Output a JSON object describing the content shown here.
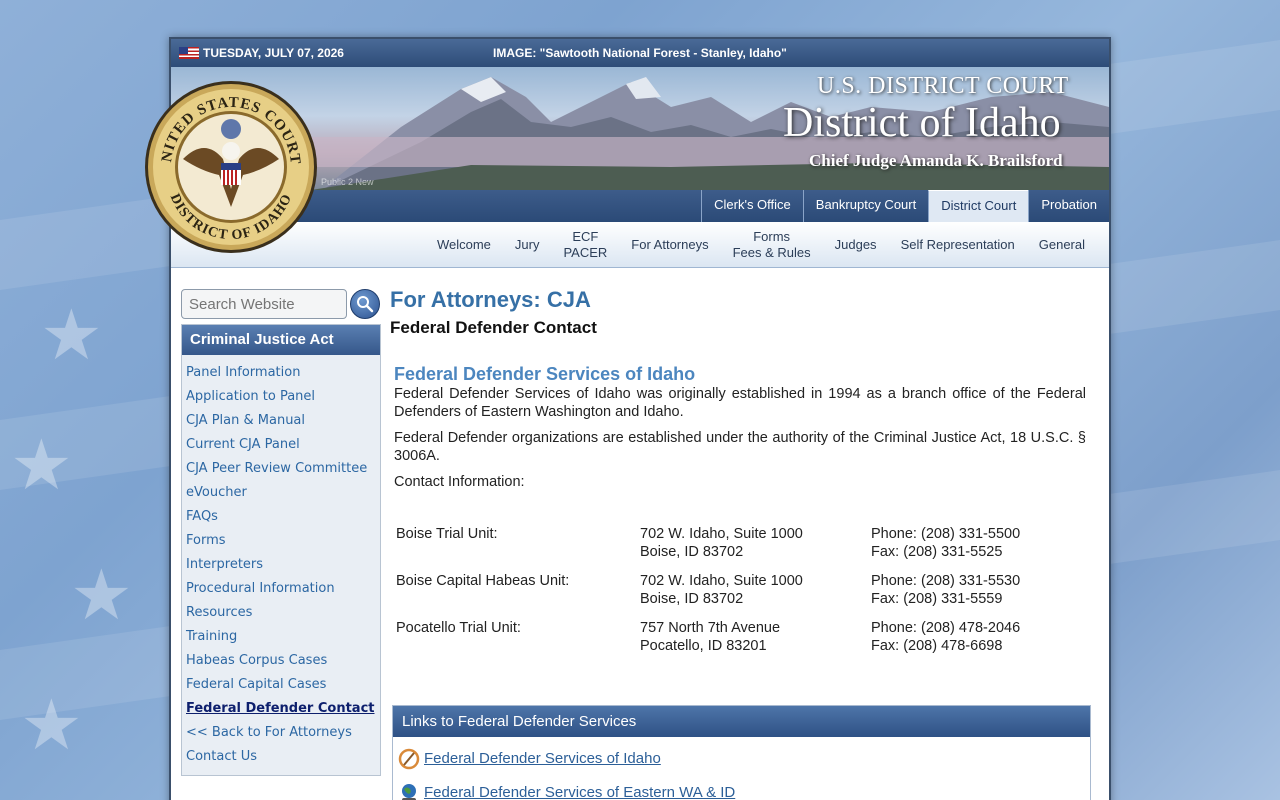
{
  "top_bar": {
    "date": "TUESDAY, JULY 07, 2026",
    "image_caption": "IMAGE: \"Sawtooth National Forest - Stanley, Idaho\""
  },
  "banner": {
    "court": "U.S. DISTRICT COURT",
    "district": "District of Idaho",
    "judge": "Chief Judge Amanda K. Brailsford",
    "small_text": "Public 2 New"
  },
  "seal": {
    "top_text": "UNITED STATES COURTS",
    "bottom_text": "DISTRICT OF IDAHO"
  },
  "tabs": [
    "Clerk's Office",
    "Bankruptcy Court",
    "District Court",
    "Probation"
  ],
  "active_tab": "District Court",
  "subnav": [
    {
      "line1": "Welcome",
      "line2": ""
    },
    {
      "line1": "Jury",
      "line2": ""
    },
    {
      "line1": "ECF",
      "line2": "PACER"
    },
    {
      "line1": "For Attorneys",
      "line2": ""
    },
    {
      "line1": "Forms",
      "line2": "Fees & Rules"
    },
    {
      "line1": "Judges",
      "line2": ""
    },
    {
      "line1": "Self Representation",
      "line2": ""
    },
    {
      "line1": "General",
      "line2": ""
    }
  ],
  "search": {
    "placeholder": "Search Website"
  },
  "sidebar": {
    "heading": "Criminal Justice Act",
    "items": [
      "Panel Information",
      "Application to Panel",
      "CJA Plan & Manual",
      "Current CJA Panel",
      "CJA Peer Review Committee",
      "eVoucher",
      "FAQs",
      "Forms",
      "Interpreters",
      "Procedural Information",
      "Resources",
      "Training",
      "Habeas Corpus Cases",
      "Federal Capital Cases",
      "Federal Defender Contact",
      "<< Back to For Attorneys",
      "Contact Us"
    ],
    "current_item": "Federal Defender Contact"
  },
  "main": {
    "title": "For Attorneys: CJA",
    "subtitle": "Federal Defender Contact",
    "section_title": "Federal Defender Services of Idaho",
    "para1": "Federal Defender Services of Idaho was originally established in 1994 as a branch office of the Federal Defenders of Eastern Washington and Idaho.",
    "para2": "Federal Defender organizations are established under the authority of the Criminal Justice Act, 18 U.S.C. § 3006A.",
    "para3": "Contact Information:",
    "contacts": [
      {
        "unit": "Boise Trial Unit:",
        "addr1": "702 W. Idaho, Suite 1000",
        "addr2": "Boise, ID  83702",
        "phone": "Phone: (208) 331-5500",
        "fax": "Fax: (208) 331-5525"
      },
      {
        "unit": "Boise Capital Habeas Unit:",
        "addr1": "702 W. Idaho, Suite 1000",
        "addr2": "Boise, ID  83702",
        "phone": "Phone: (208) 331-5530",
        "fax": "Fax: (208) 331-5559"
      },
      {
        "unit": "Pocatello Trial Unit:",
        "addr1": "757 North 7th Avenue",
        "addr2": "Pocatello, ID  83201",
        "phone": "Phone: (208) 478-2046",
        "fax": "Fax: (208) 478-6698"
      }
    ]
  },
  "links_box": {
    "heading": "Links to Federal Defender Services",
    "links": [
      {
        "text": "Federal Defender Services of Idaho",
        "icon": "link-icon"
      },
      {
        "text": "Federal Defender Services of Eastern WA & ID",
        "icon": "globe-icon"
      }
    ]
  }
}
